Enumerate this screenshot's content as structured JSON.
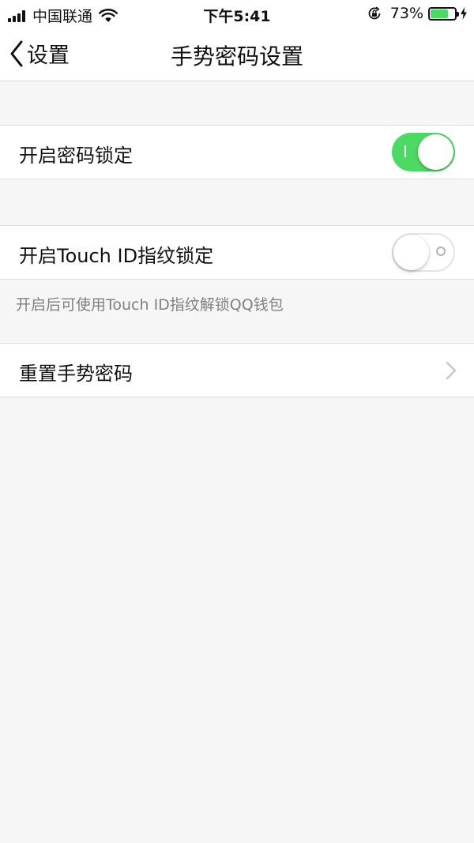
{
  "status_bar": {
    "carrier": "中国联通",
    "time": "下午5:41",
    "battery_percent": "73%",
    "battery_level": 0.73
  },
  "nav": {
    "back_label": "设置",
    "title": "手势密码设置"
  },
  "settings": {
    "enable_lock": {
      "label": "开启密码锁定",
      "on": true
    },
    "touch_id": {
      "label": "开启Touch ID指纹锁定",
      "on": false,
      "hint": "开启后可使用Touch ID指纹解锁QQ钱包"
    },
    "reset": {
      "label": "重置手势密码"
    }
  },
  "colors": {
    "switch_on": "#4cd964",
    "background": "#f6f6f6",
    "hint_text": "#808080"
  }
}
